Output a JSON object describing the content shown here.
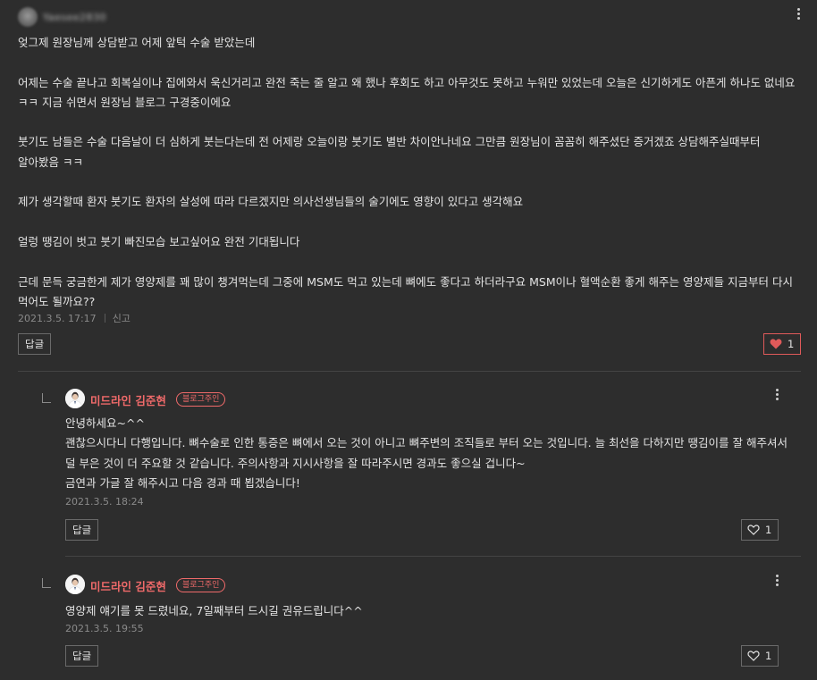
{
  "comment": {
    "author_name": "Yaesee2830",
    "text": "엊그제 원장님께 상담받고 어제 앞턱 수술 받았는데\n\n어제는 수술 끝나고 회복실이나 집에와서 욱신거리고 완전 죽는 줄 알고 왜 했나 후회도 하고 아무것도 못하고 누워만 있었는데 오늘은 신기하게도 아픈게 하나도 없네요 ㅋㅋ 지금 쉬면서 원장님 블로그 구경중이에요\n\n붓기도 남들은 수술 다음날이 더 심하게 붓는다는데 전 어제랑 오늘이랑 붓기도 별반 차이안나네요 그만큼 원장님이 꼼꼼히 해주셨단 증거겠죠 상담해주실때부터 알아봤음 ㅋㅋ\n\n제가 생각할때 환자 붓기도 환자의 살성에 따라 다르겠지만 의사선생님들의 술기에도 영향이 있다고 생각해요\n\n얼렁 땡김이 벗고 붓기 빠진모습 보고싶어요 완전 기대됩니다\n\n근데 문득 궁금한게 제가 영양제를 꽤 많이 챙겨먹는데 그중에 MSM도 먹고 있는데 뼈에도 좋다고 하더라구요 MSM이나 혈액순환 좋게 해주는 영양제들 지금부터 다시 먹어도 될까요??",
    "date": "2021.3.5. 17:17",
    "report_label": "신고",
    "reply_label": "답글",
    "like_count": "1",
    "liked": true
  },
  "replies": [
    {
      "author": "미드라인 김준현",
      "badge": "블로그주인",
      "text": "안녕하세요~^^\n괜찮으시다니 다행입니다. 뼈수술로 인한 통증은 뼈에서 오는 것이 아니고 뼈주변의 조직들로 부터 오는 것입니다. 늘 최선을 다하지만 땡김이를 잘 해주셔서 덜 부은 것이 더 주요할 것 같습니다. 주의사항과 지시사항을 잘 따라주시면 경과도 좋으실 겁니다~\n금연과 가글 잘 해주시고 다음 경과 때 뵙겠습니다!",
      "date": "2021.3.5.  18:24",
      "reply_label": "답글",
      "like_count": "1"
    },
    {
      "author": "미드라인 김준현",
      "badge": "블로그주인",
      "text": "영양제 얘기를 못 드렸네요, 7일째부터 드시길 권유드립니다^^",
      "date": "2021.3.5.  19:55",
      "reply_label": "답글",
      "like_count": "1"
    }
  ],
  "colors": {
    "background": "#2d2d2d",
    "owner_accent": "#f06a6a",
    "like_heart_active": "#e05a5a"
  },
  "icons": {
    "more": "more-vertical-icon",
    "heart_filled": "heart-filled-icon",
    "heart_outline": "heart-outline-icon",
    "reply_elbow": "reply-elbow-icon"
  }
}
